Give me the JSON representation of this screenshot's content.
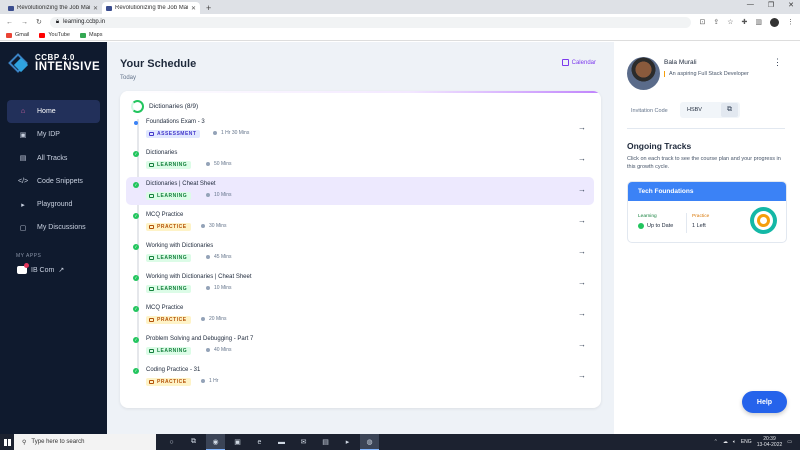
{
  "browser": {
    "tabs": [
      {
        "title": "Revolutionizing the Job Market |"
      },
      {
        "title": "Revolutionizing the Job Market |"
      }
    ],
    "new_tab": "+",
    "url": "learning.ccbp.in",
    "bookmarks": [
      {
        "label": "Gmail",
        "color": "#ea4335"
      },
      {
        "label": "YouTube",
        "color": "#ff0000"
      },
      {
        "label": "Maps",
        "color": "#34a853"
      }
    ]
  },
  "sidebar": {
    "logo_line1": "CCBP 4.0",
    "logo_line2": "INTENSIVE",
    "nav": [
      {
        "label": "Home",
        "icon": "home-icon",
        "glyph": "⌂",
        "active": true
      },
      {
        "label": "My IDP",
        "icon": "idp-icon",
        "glyph": "▣",
        "active": false
      },
      {
        "label": "All Tracks",
        "icon": "tracks-icon",
        "glyph": "▤",
        "active": false
      },
      {
        "label": "Code Snippets",
        "icon": "code-icon",
        "glyph": "</>",
        "active": false
      },
      {
        "label": "Playground",
        "icon": "terminal-icon",
        "glyph": "▸",
        "active": false
      },
      {
        "label": "My Discussions",
        "icon": "discussion-icon",
        "glyph": "▢",
        "active": false
      }
    ],
    "my_apps_label": "MY APPS",
    "app_label": "IB Com",
    "external_glyph": "↗"
  },
  "schedule": {
    "title": "Your Schedule",
    "subtitle": "Today",
    "calendar_label": "Calendar",
    "group_title": "Dictionaries (8/9)",
    "items": [
      {
        "title": "Foundations Exam - 3",
        "tag": "ASSESSMENT",
        "kind": "assessment",
        "duration": "1 Hr 30 Mins",
        "done": false,
        "highlight": false
      },
      {
        "title": "Dictionaries",
        "tag": "LEARNING",
        "kind": "learning",
        "duration": "50 Mins",
        "done": true,
        "highlight": false
      },
      {
        "title": "Dictionaries | Cheat Sheet",
        "tag": "LEARNING",
        "kind": "learning",
        "duration": "10 Mins",
        "done": true,
        "highlight": true
      },
      {
        "title": "MCQ Practice",
        "tag": "PRACTICE",
        "kind": "practice",
        "duration": "30 Mins",
        "done": true,
        "highlight": false
      },
      {
        "title": "Working with Dictionaries",
        "tag": "LEARNING",
        "kind": "learning",
        "duration": "45 Mins",
        "done": true,
        "highlight": false
      },
      {
        "title": "Working with Dictionaries | Cheat Sheet",
        "tag": "LEARNING",
        "kind": "learning",
        "duration": "10 Mins",
        "done": true,
        "highlight": false
      },
      {
        "title": "MCQ Practice",
        "tag": "PRACTICE",
        "kind": "practice",
        "duration": "20 Mins",
        "done": true,
        "highlight": false
      },
      {
        "title": "Problem Solving and Debugging - Part 7",
        "tag": "LEARNING",
        "kind": "learning",
        "duration": "40 Mins",
        "done": true,
        "highlight": false
      },
      {
        "title": "Coding Practice - 31",
        "tag": "PRACTICE",
        "kind": "practice",
        "duration": "1 Hr",
        "done": true,
        "highlight": false
      }
    ]
  },
  "profile": {
    "name": "Bala  Murali",
    "tagline": "An aspiring Full Stack Developer",
    "invitation_label": "Invitation Code",
    "invitation_code": "HSBV"
  },
  "ongoing": {
    "title": "Ongoing Tracks",
    "description": "Click on each track to see the course plan and your progress in this growth cycle.",
    "track_name": "Tech Foundations",
    "learning_label": "Learning",
    "learning_value": "Up to Date",
    "practice_label": "Practice",
    "practice_value": "1 Left"
  },
  "help_label": "Help",
  "taskbar": {
    "search_placeholder": "Type here to search",
    "lang": "ENG",
    "time": "20:39",
    "date": "13-04-2022"
  }
}
